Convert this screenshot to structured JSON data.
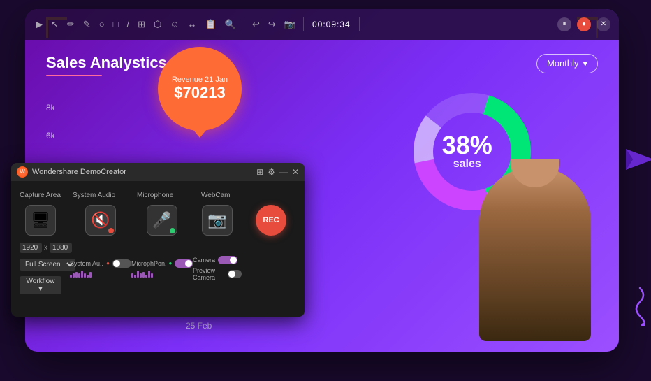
{
  "app": {
    "title": "Wondershare DemoCreator"
  },
  "toolbar": {
    "timer": "00:09:34",
    "icons": [
      "▶",
      "✎",
      "✏",
      "○",
      "□",
      "⟋",
      "⬜",
      "⊕",
      "☺",
      "↔",
      "📋",
      "🔍",
      "↩",
      "↪",
      "📷"
    ]
  },
  "dashboard": {
    "title": "Sales Analystics",
    "revenue_tooltip": {
      "date": "Revenue 21 Jan",
      "amount": "$70213"
    },
    "chart_labels": {
      "8k": "8k",
      "6k": "6k"
    },
    "date_label": "25 Feb",
    "monthly_label": "Monthly",
    "donut": {
      "percent": "38%",
      "label": "sales"
    }
  },
  "panel": {
    "title": "Wondershare DemoCreator",
    "sections": {
      "capture_area": "Capture Area",
      "system_audio": "System Audio",
      "microphone": "Microphone",
      "webcam": "WebCam"
    },
    "resolution": {
      "width": "1920",
      "height": "1080",
      "separator": "x"
    },
    "modes": {
      "full_screen": "Full Screen",
      "workflow": "Workflow ▼"
    },
    "system_audio_label": "System Au...",
    "microphone_label": "MicrophPon...",
    "camera_label": "Camera",
    "preview_camera": "Preview Camera",
    "rec_label": "REC"
  }
}
